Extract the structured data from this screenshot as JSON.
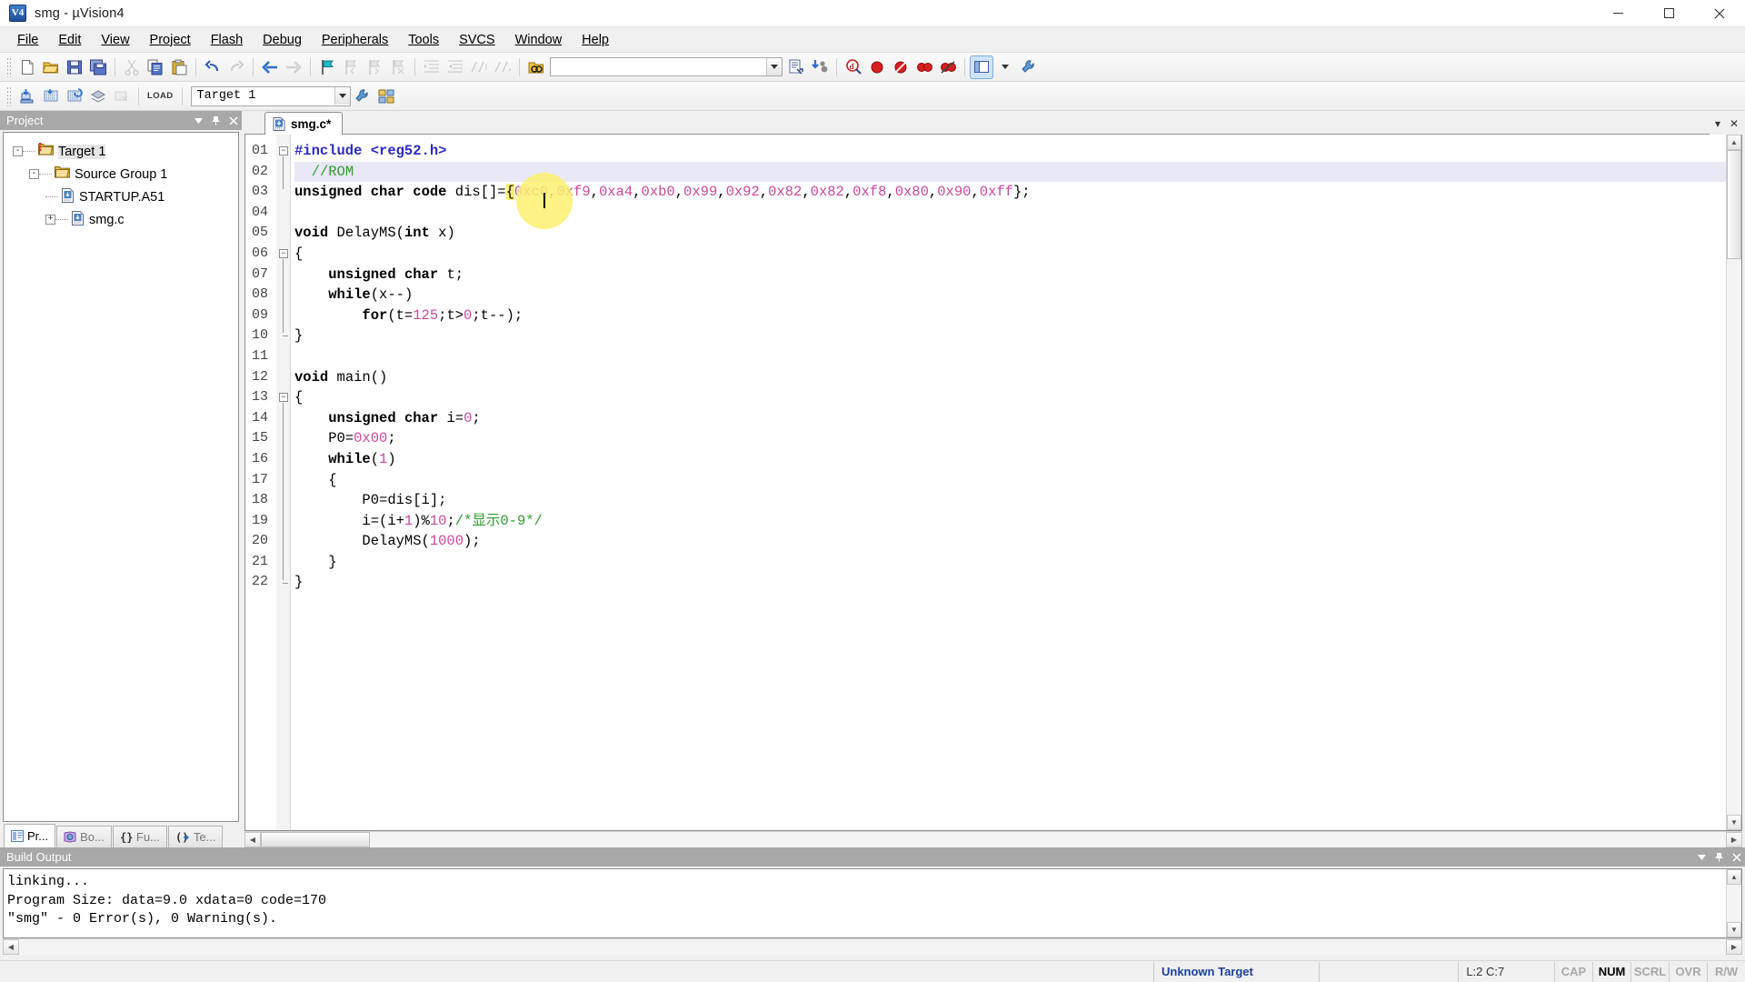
{
  "window": {
    "title": "smg  - µVision4",
    "icon": "keil-uvision-logo",
    "minimize": "minimize-button",
    "maximize": "maximize-button",
    "close": "close-button"
  },
  "menubar": {
    "items": [
      {
        "label": "File"
      },
      {
        "label": "Edit"
      },
      {
        "label": "View"
      },
      {
        "label": "Project"
      },
      {
        "label": "Flash"
      },
      {
        "label": "Debug"
      },
      {
        "label": "Peripherals"
      },
      {
        "label": "Tools"
      },
      {
        "label": "SVCS"
      },
      {
        "label": "Window"
      },
      {
        "label": "Help"
      }
    ]
  },
  "toolbar_main": {
    "buttons": [
      {
        "name": "new-file-icon",
        "title": "New"
      },
      {
        "name": "open-file-icon",
        "title": "Open"
      },
      {
        "name": "save-icon",
        "title": "Save"
      },
      {
        "name": "save-all-icon",
        "title": "Save All"
      },
      {
        "name": "cut-icon",
        "title": "Cut"
      },
      {
        "name": "copy-icon",
        "title": "Copy"
      },
      {
        "name": "paste-icon",
        "title": "Paste"
      },
      {
        "name": "undo-icon",
        "title": "Undo"
      },
      {
        "name": "redo-icon",
        "title": "Redo"
      },
      {
        "name": "navigate-back-icon",
        "title": "Back"
      },
      {
        "name": "navigate-forward-icon",
        "title": "Forward"
      },
      {
        "name": "bookmark-toggle-icon",
        "title": "Insert/Remove Bookmark"
      },
      {
        "name": "bookmark-prev-icon",
        "title": "Previous Bookmark"
      },
      {
        "name": "bookmark-next-icon",
        "title": "Next Bookmark"
      },
      {
        "name": "bookmark-clear-icon",
        "title": "Clear All Bookmarks"
      },
      {
        "name": "indent-icon",
        "title": "Indent"
      },
      {
        "name": "outdent-icon",
        "title": "Outdent"
      },
      {
        "name": "comment-icon",
        "title": "Comment Selection"
      },
      {
        "name": "uncomment-icon",
        "title": "Uncomment Selection"
      },
      {
        "name": "find-in-files-icon",
        "title": "Find in Files"
      }
    ],
    "search": {
      "value": "",
      "placeholder": ""
    },
    "after_search": [
      {
        "name": "source-browse-icon",
        "title": "Source Browse"
      },
      {
        "name": "configure-icon",
        "title": "Configure"
      },
      {
        "name": "find-icon",
        "title": "Find"
      },
      {
        "name": "breakpoint-icon",
        "title": "Insert/Remove Breakpoint"
      },
      {
        "name": "breakpoint-disable-icon",
        "title": "Enable/Disable Breakpoint"
      },
      {
        "name": "breakpoint-disable-all-icon",
        "title": "Disable All Breakpoints"
      },
      {
        "name": "breakpoint-kill-all-icon",
        "title": "Kill All Breakpoints"
      },
      {
        "name": "window-layout-icon",
        "title": "Window Layout"
      },
      {
        "name": "configure-target-icon",
        "title": "Configure Target"
      }
    ]
  },
  "toolbar_build": {
    "buttons": [
      {
        "name": "translate-file-icon",
        "title": "Translate"
      },
      {
        "name": "build-target-icon",
        "title": "Build Target"
      },
      {
        "name": "rebuild-all-icon",
        "title": "Rebuild All Target Files"
      },
      {
        "name": "batch-build-icon",
        "title": "Batch Build"
      },
      {
        "name": "stop-build-icon",
        "title": "Stop Build"
      }
    ],
    "load_label": "LOAD",
    "target": {
      "value": "Target 1",
      "name": "target-select"
    },
    "trailing": [
      {
        "name": "target-options-icon",
        "title": "Options for Target"
      },
      {
        "name": "manage-components-icon",
        "title": "Manage Components"
      }
    ]
  },
  "project_panel": {
    "caption": "Project",
    "menu_icon": "chevron-down-icon",
    "pin_icon": "pin-icon",
    "close_icon": "close-icon",
    "tree": [
      {
        "label": "Target 1",
        "depth": 0,
        "toggle": "-",
        "icon": "target-icon",
        "selected": true
      },
      {
        "label": "Source Group 1",
        "depth": 1,
        "toggle": "-",
        "icon": "folder-icon",
        "selected": false
      },
      {
        "label": "STARTUP.A51",
        "depth": 2,
        "toggle": "",
        "icon": "source-file-icon",
        "selected": false
      },
      {
        "label": "smg.c",
        "depth": 2,
        "toggle": "+",
        "icon": "source-file-icon",
        "selected": false
      }
    ],
    "tabs": [
      {
        "label": "Pr...",
        "icon": "project-icon",
        "active": true
      },
      {
        "label": "Bo...",
        "icon": "books-icon",
        "active": false
      },
      {
        "label": "Fu...",
        "icon": "functions-icon",
        "active": false
      },
      {
        "label": "Te...",
        "icon": "templates-icon",
        "active": false
      }
    ]
  },
  "editor": {
    "tabs": [
      {
        "label": "smg.c*",
        "icon": "c-source-icon",
        "active": true
      }
    ],
    "tabbar_buttons": [
      {
        "name": "tabbar-list-icon",
        "glyph": "▾"
      },
      {
        "name": "tabbar-close-icon",
        "glyph": "✕"
      }
    ],
    "lines": [
      {
        "n": "01",
        "fold": "-",
        "text": "#include <reg52.h>"
      },
      {
        "n": "02",
        "fold": "",
        "text": "  //ROM",
        "highlight": true
      },
      {
        "n": "03",
        "fold": "",
        "text": "unsigned char code dis[]={0xc0,0xf9,0xa4,0xb0,0x99,0x92,0x82,0x82,0xf8,0x80,0x90,0xff};"
      },
      {
        "n": "04",
        "fold": "",
        "text": ""
      },
      {
        "n": "05",
        "fold": "",
        "text": "void DelayMS(int x)"
      },
      {
        "n": "06",
        "fold": "-",
        "text": "{"
      },
      {
        "n": "07",
        "fold": "",
        "text": "    unsigned char t;"
      },
      {
        "n": "08",
        "fold": "",
        "text": "    while(x--)"
      },
      {
        "n": "09",
        "fold": "",
        "text": "        for(t=125;t>0;t--);"
      },
      {
        "n": "10",
        "fold": "",
        "text": "}"
      },
      {
        "n": "11",
        "fold": "",
        "text": ""
      },
      {
        "n": "12",
        "fold": "",
        "text": "void main()"
      },
      {
        "n": "13",
        "fold": "-",
        "text": "{"
      },
      {
        "n": "14",
        "fold": "",
        "text": "    unsigned char i=0;"
      },
      {
        "n": "15",
        "fold": "",
        "text": "    P0=0x00;"
      },
      {
        "n": "16",
        "fold": "",
        "text": "    while(1)"
      },
      {
        "n": "17",
        "fold": "",
        "text": "    {"
      },
      {
        "n": "18",
        "fold": "",
        "text": "        P0=dis[i];"
      },
      {
        "n": "19",
        "fold": "",
        "text": "        i=(i+1)%10;/*显示0-9*/"
      },
      {
        "n": "20",
        "fold": "",
        "text": "        DelayMS(1000);"
      },
      {
        "n": "21",
        "fold": "",
        "text": "    }"
      },
      {
        "n": "22",
        "fold": "",
        "text": "}"
      }
    ]
  },
  "build_output": {
    "caption": "Build Output",
    "menu_icon": "chevron-down-icon",
    "pin_icon": "pin-icon",
    "close_icon": "close-icon",
    "lines": [
      "linking...",
      "Program Size: data=9.0 xdata=0 code=170",
      "\"smg\" - 0 Error(s), 0 Warning(s)."
    ]
  },
  "statusbar": {
    "target": "Unknown Target",
    "position": "L:2 C:7",
    "flags": [
      {
        "label": "CAP",
        "on": false
      },
      {
        "label": "NUM",
        "on": true
      },
      {
        "label": "SCRL",
        "on": false
      },
      {
        "label": "OVR",
        "on": false
      },
      {
        "label": "R/W",
        "on": false
      }
    ]
  },
  "colors": {
    "caption_bg": "#a8a8a8",
    "keyword": "#000000",
    "number": "#c8489c",
    "comment": "#2e9b2e",
    "preprocessor": "#2b2bc0",
    "highlight_line": "#e8e8f6",
    "brace_match": "#fff06a",
    "status_target": "#1b3f9b"
  }
}
